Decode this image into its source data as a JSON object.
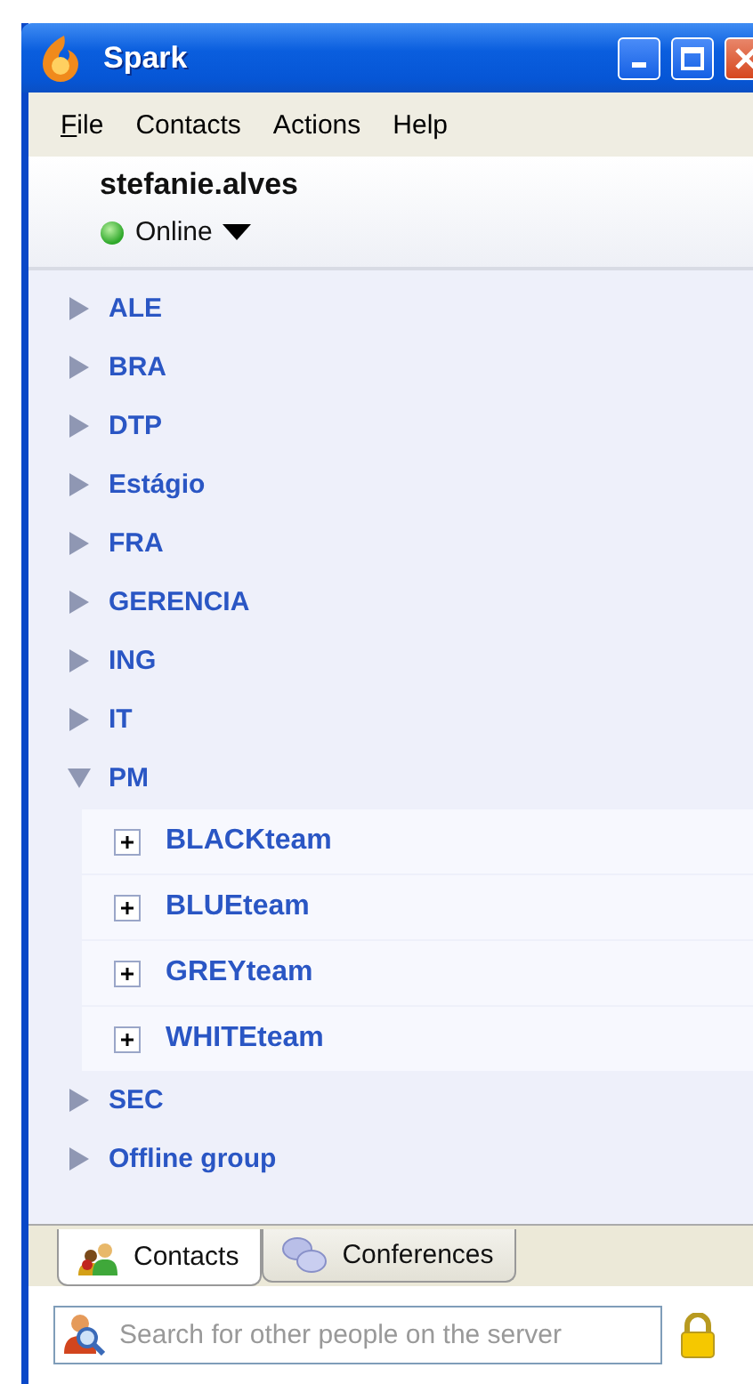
{
  "window": {
    "title": "Spark"
  },
  "menu": [
    {
      "label": "File",
      "mnemonic_first": true
    },
    {
      "label": "Contacts"
    },
    {
      "label": "Actions"
    },
    {
      "label": "Help"
    }
  ],
  "user": {
    "name": "stefanie.alves",
    "status": "Online"
  },
  "groups": [
    {
      "label": "ALE",
      "expanded": false
    },
    {
      "label": "BRA",
      "expanded": false
    },
    {
      "label": "DTP",
      "expanded": false
    },
    {
      "label": "Estágio",
      "expanded": false
    },
    {
      "label": "FRA",
      "expanded": false
    },
    {
      "label": "GERENCIA",
      "expanded": false
    },
    {
      "label": "ING",
      "expanded": false
    },
    {
      "label": "IT",
      "expanded": false
    },
    {
      "label": "PM",
      "expanded": true,
      "children": [
        {
          "label": "BLACKteam",
          "expanded": false
        },
        {
          "label": "BLUEteam",
          "expanded": false
        },
        {
          "label": "GREYteam",
          "expanded": false
        },
        {
          "label": "WHITEteam",
          "expanded": false
        }
      ]
    },
    {
      "label": "SEC",
      "expanded": false
    },
    {
      "label": "Offline group",
      "expanded": false
    }
  ],
  "tabs": [
    {
      "label": "Contacts",
      "selected": true,
      "kind": "contacts"
    },
    {
      "label": "Conferences",
      "selected": false,
      "kind": "conferences"
    }
  ],
  "search": {
    "placeholder": "Search for other people on the server"
  }
}
